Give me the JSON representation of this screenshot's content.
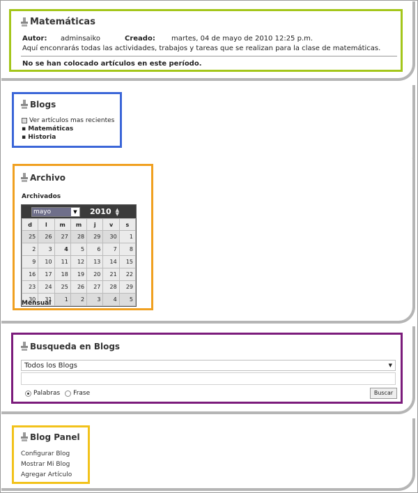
{
  "matematicas": {
    "title": "Matemáticas",
    "autor_label": "Autor:",
    "autor": "adminsaiko",
    "creado_label": "Creado:",
    "creado": "martes, 04 de mayo de 2010 12:25 p.m.",
    "description": "Aquí enconrarás todas las actividades, trabajos y tareas que se realizan para la clase de matemáticas.",
    "no_articles": "No se han colocado artículos en este período."
  },
  "blogs": {
    "title": "Blogs",
    "recent": "Ver artículos mas recientes",
    "items": [
      "Matemáticas",
      "Historia"
    ]
  },
  "archivo": {
    "title": "Archivo",
    "subtitle": "Archivados",
    "month": "mayo",
    "year": "2010",
    "weekdays": [
      "d",
      "l",
      "m",
      "m",
      "j",
      "v",
      "s"
    ],
    "weeks": [
      [
        "25",
        "26",
        "27",
        "28",
        "29",
        "30",
        "1"
      ],
      [
        "2",
        "3",
        "4",
        "5",
        "6",
        "7",
        "8"
      ],
      [
        "9",
        "10",
        "11",
        "12",
        "13",
        "14",
        "15"
      ],
      [
        "16",
        "17",
        "18",
        "19",
        "20",
        "21",
        "22"
      ],
      [
        "23",
        "24",
        "25",
        "26",
        "27",
        "28",
        "29"
      ],
      [
        "30",
        "31",
        "1",
        "2",
        "3",
        "4",
        "5"
      ]
    ],
    "footer": "Mensual"
  },
  "busqueda": {
    "title": "Busqueda en Blogs",
    "select_value": "Todos los Blogs",
    "radio_palabras": "Palabras",
    "radio_frase": "Frase",
    "button": "Buscar"
  },
  "panel": {
    "title": "Blog Panel",
    "links": [
      "Configurar Blog",
      "Mostrar Mi Blog",
      "Agregar Artículo"
    ]
  },
  "colors": {
    "outline_green": "#a4c61a",
    "outline_blue": "#3b66d8",
    "outline_orange": "#f0a020",
    "outline_purple": "#7b1b7b",
    "outline_yellow": "#f2c21b"
  }
}
